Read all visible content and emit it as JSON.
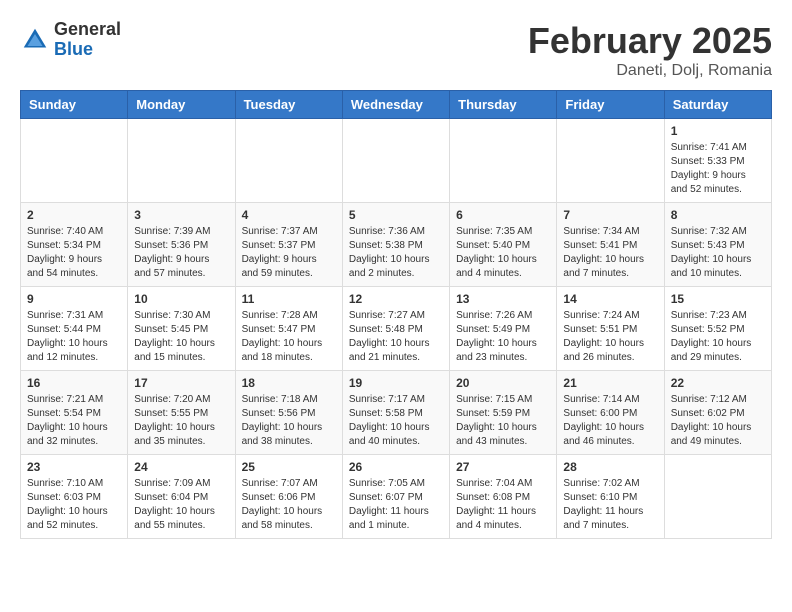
{
  "header": {
    "logo_general": "General",
    "logo_blue": "Blue",
    "title": "February 2025",
    "location": "Daneti, Dolj, Romania"
  },
  "weekdays": [
    "Sunday",
    "Monday",
    "Tuesday",
    "Wednesday",
    "Thursday",
    "Friday",
    "Saturday"
  ],
  "weeks": [
    [
      {
        "day": "",
        "info": ""
      },
      {
        "day": "",
        "info": ""
      },
      {
        "day": "",
        "info": ""
      },
      {
        "day": "",
        "info": ""
      },
      {
        "day": "",
        "info": ""
      },
      {
        "day": "",
        "info": ""
      },
      {
        "day": "1",
        "info": "Sunrise: 7:41 AM\nSunset: 5:33 PM\nDaylight: 9 hours and 52 minutes."
      }
    ],
    [
      {
        "day": "2",
        "info": "Sunrise: 7:40 AM\nSunset: 5:34 PM\nDaylight: 9 hours and 54 minutes."
      },
      {
        "day": "3",
        "info": "Sunrise: 7:39 AM\nSunset: 5:36 PM\nDaylight: 9 hours and 57 minutes."
      },
      {
        "day": "4",
        "info": "Sunrise: 7:37 AM\nSunset: 5:37 PM\nDaylight: 9 hours and 59 minutes."
      },
      {
        "day": "5",
        "info": "Sunrise: 7:36 AM\nSunset: 5:38 PM\nDaylight: 10 hours and 2 minutes."
      },
      {
        "day": "6",
        "info": "Sunrise: 7:35 AM\nSunset: 5:40 PM\nDaylight: 10 hours and 4 minutes."
      },
      {
        "day": "7",
        "info": "Sunrise: 7:34 AM\nSunset: 5:41 PM\nDaylight: 10 hours and 7 minutes."
      },
      {
        "day": "8",
        "info": "Sunrise: 7:32 AM\nSunset: 5:43 PM\nDaylight: 10 hours and 10 minutes."
      }
    ],
    [
      {
        "day": "9",
        "info": "Sunrise: 7:31 AM\nSunset: 5:44 PM\nDaylight: 10 hours and 12 minutes."
      },
      {
        "day": "10",
        "info": "Sunrise: 7:30 AM\nSunset: 5:45 PM\nDaylight: 10 hours and 15 minutes."
      },
      {
        "day": "11",
        "info": "Sunrise: 7:28 AM\nSunset: 5:47 PM\nDaylight: 10 hours and 18 minutes."
      },
      {
        "day": "12",
        "info": "Sunrise: 7:27 AM\nSunset: 5:48 PM\nDaylight: 10 hours and 21 minutes."
      },
      {
        "day": "13",
        "info": "Sunrise: 7:26 AM\nSunset: 5:49 PM\nDaylight: 10 hours and 23 minutes."
      },
      {
        "day": "14",
        "info": "Sunrise: 7:24 AM\nSunset: 5:51 PM\nDaylight: 10 hours and 26 minutes."
      },
      {
        "day": "15",
        "info": "Sunrise: 7:23 AM\nSunset: 5:52 PM\nDaylight: 10 hours and 29 minutes."
      }
    ],
    [
      {
        "day": "16",
        "info": "Sunrise: 7:21 AM\nSunset: 5:54 PM\nDaylight: 10 hours and 32 minutes."
      },
      {
        "day": "17",
        "info": "Sunrise: 7:20 AM\nSunset: 5:55 PM\nDaylight: 10 hours and 35 minutes."
      },
      {
        "day": "18",
        "info": "Sunrise: 7:18 AM\nSunset: 5:56 PM\nDaylight: 10 hours and 38 minutes."
      },
      {
        "day": "19",
        "info": "Sunrise: 7:17 AM\nSunset: 5:58 PM\nDaylight: 10 hours and 40 minutes."
      },
      {
        "day": "20",
        "info": "Sunrise: 7:15 AM\nSunset: 5:59 PM\nDaylight: 10 hours and 43 minutes."
      },
      {
        "day": "21",
        "info": "Sunrise: 7:14 AM\nSunset: 6:00 PM\nDaylight: 10 hours and 46 minutes."
      },
      {
        "day": "22",
        "info": "Sunrise: 7:12 AM\nSunset: 6:02 PM\nDaylight: 10 hours and 49 minutes."
      }
    ],
    [
      {
        "day": "23",
        "info": "Sunrise: 7:10 AM\nSunset: 6:03 PM\nDaylight: 10 hours and 52 minutes."
      },
      {
        "day": "24",
        "info": "Sunrise: 7:09 AM\nSunset: 6:04 PM\nDaylight: 10 hours and 55 minutes."
      },
      {
        "day": "25",
        "info": "Sunrise: 7:07 AM\nSunset: 6:06 PM\nDaylight: 10 hours and 58 minutes."
      },
      {
        "day": "26",
        "info": "Sunrise: 7:05 AM\nSunset: 6:07 PM\nDaylight: 11 hours and 1 minute."
      },
      {
        "day": "27",
        "info": "Sunrise: 7:04 AM\nSunset: 6:08 PM\nDaylight: 11 hours and 4 minutes."
      },
      {
        "day": "28",
        "info": "Sunrise: 7:02 AM\nSunset: 6:10 PM\nDaylight: 11 hours and 7 minutes."
      },
      {
        "day": "",
        "info": ""
      }
    ]
  ]
}
